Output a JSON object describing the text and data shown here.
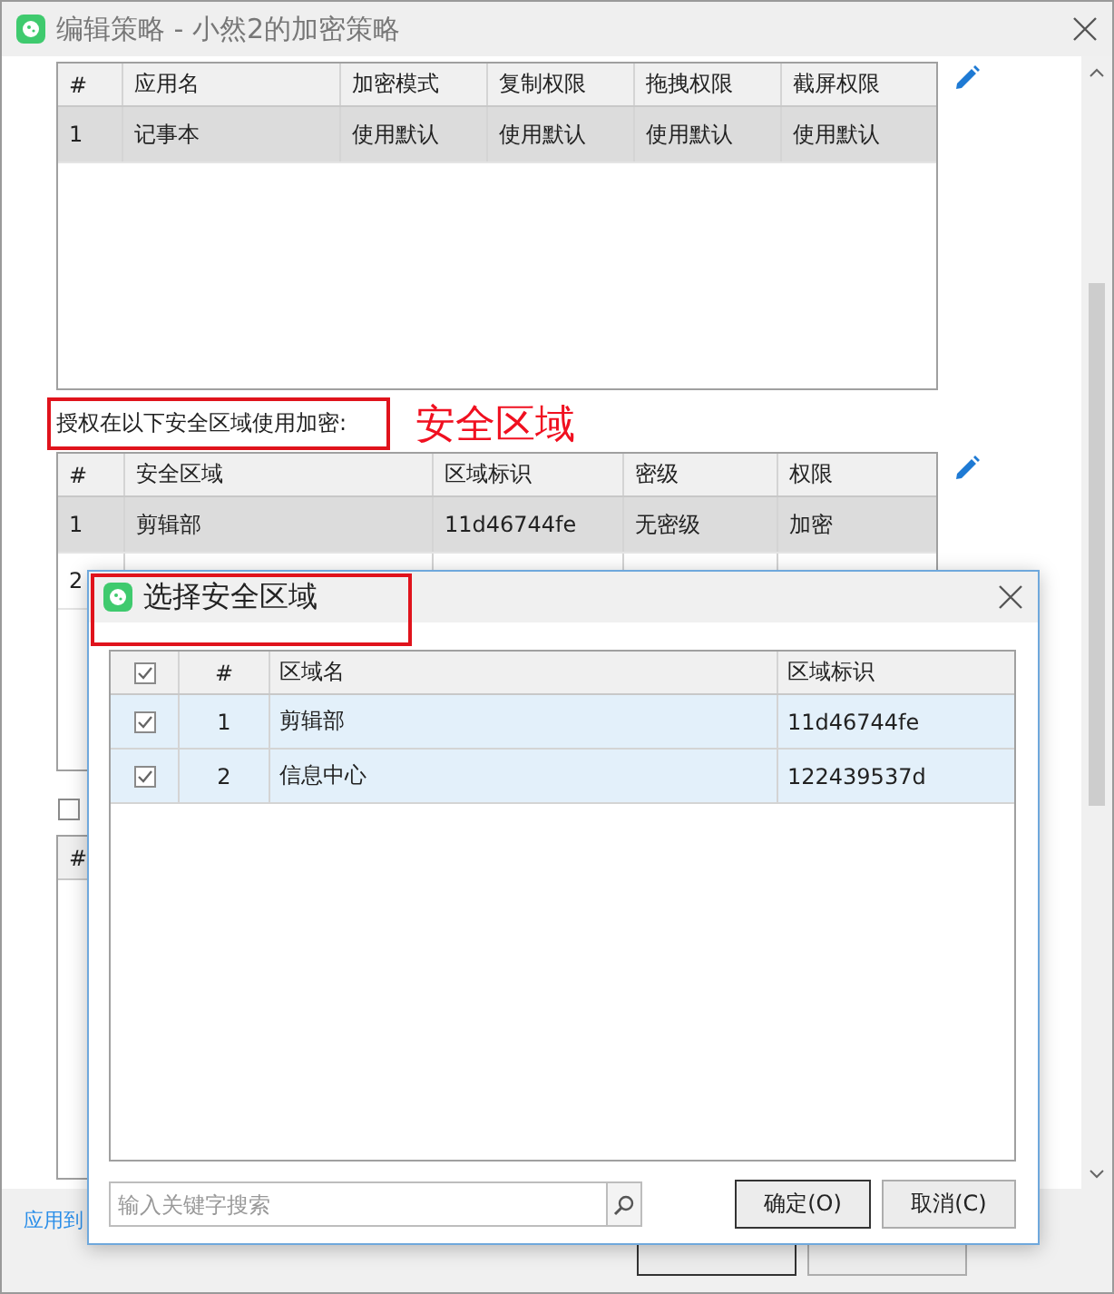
{
  "window": {
    "title": "编辑策略 - 小然2的加密策略"
  },
  "app_table": {
    "columns": [
      "#",
      "应用名",
      "加密模式",
      "复制权限",
      "拖拽权限",
      "截屏权限"
    ],
    "rows": [
      {
        "selected": true,
        "cells": [
          "1",
          "记事本",
          "使用默认",
          "使用默认",
          "使用默认",
          "使用默认"
        ]
      }
    ]
  },
  "zone_label": "授权在以下安全区域使用加密:",
  "annotation": "安全区域",
  "zone_table": {
    "columns": [
      "#",
      "安全区域",
      "区域标识",
      "密级",
      "权限"
    ],
    "rows": [
      {
        "selected": true,
        "cells": [
          "1",
          "剪辑部",
          "11d46744fe",
          "无密级",
          "加密"
        ]
      },
      {
        "selected": false,
        "cells": [
          "2"
        ]
      }
    ]
  },
  "option_checkbox": {
    "checked": false
  },
  "third_table": {
    "columns": [
      "#"
    ]
  },
  "apply_link": "应用到",
  "dialog": {
    "title": "选择安全区域",
    "header_checked": true,
    "columns": [
      "#",
      "区域名",
      "区域标识"
    ],
    "rows": [
      {
        "checked": true,
        "cells": [
          "1",
          "剪辑部",
          "11d46744fe"
        ]
      },
      {
        "checked": true,
        "cells": [
          "2",
          "信息中心",
          "122439537d"
        ]
      }
    ],
    "search": {
      "placeholder": "输入关键字搜索"
    },
    "buttons": [
      "确定(O)",
      "取消(C)"
    ]
  }
}
